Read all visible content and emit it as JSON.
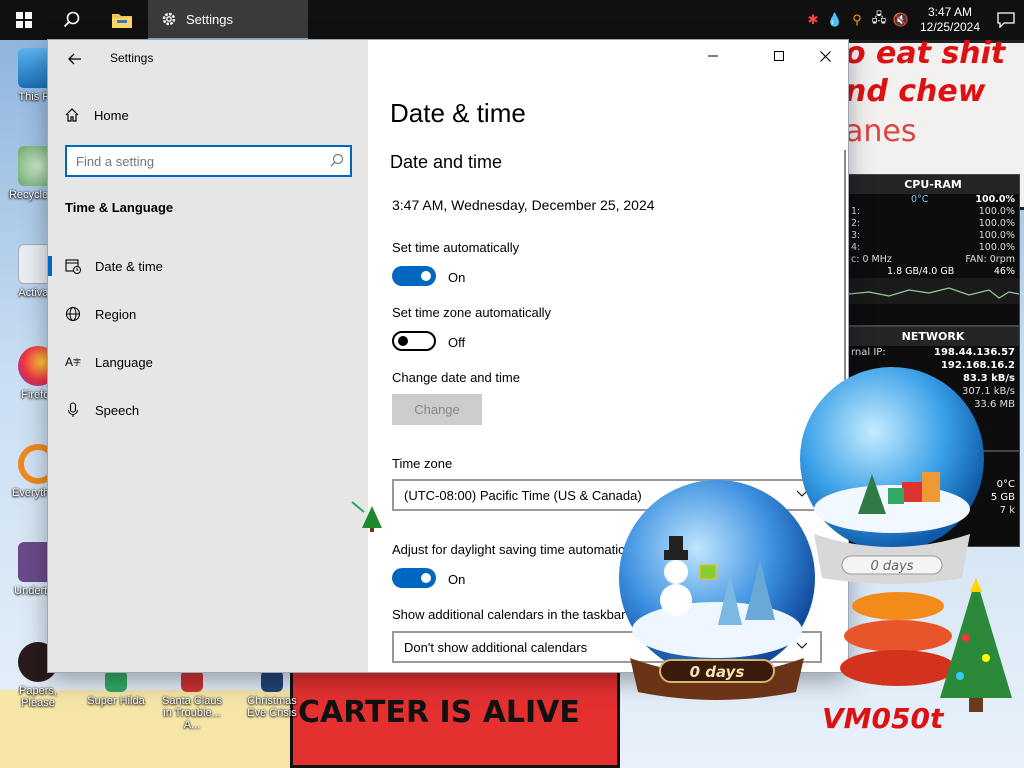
{
  "taskbar": {
    "settings_label": "Settings",
    "clock_time": "3:47 AM",
    "clock_date": "12/25/2024"
  },
  "desktop": {
    "icons": [
      {
        "label": "This PC"
      },
      {
        "label": "Recycle Bin"
      },
      {
        "label": "Activate"
      },
      {
        "label": "Firefox"
      },
      {
        "label": "Everything"
      },
      {
        "label": "Undertale"
      },
      {
        "label": "Papers, Please"
      },
      {
        "label": "Super Hilda"
      },
      {
        "label": "Santa Claus in Trouble... A..."
      },
      {
        "label": "Christmas Eve Crisis"
      }
    ],
    "wallpaper_top_lines": [
      "o eat shit",
      "nd chew",
      "anes"
    ],
    "wallpaper_bottom_lines": [
      "CARTER IS ALIVE"
    ],
    "wallpaper_tag": "VM050t",
    "globe_days_label": "0 days"
  },
  "gadgets": {
    "cpu_title": "CPU-RAM",
    "cpu_temp": "0°C",
    "cpu_total": "100.0%",
    "cores": [
      {
        "name": "1:",
        "value": "100.0%"
      },
      {
        "name": "2:",
        "value": "100.0%"
      },
      {
        "name": "3:",
        "value": "100.0%"
      },
      {
        "name": "4:",
        "value": "100.0%"
      }
    ],
    "cpu_freq": "c: 0 MHz",
    "fan": "FAN: 0rpm",
    "ram": "1.8 GB/4.0 GB",
    "ram_pct": "46%",
    "net_title": "NETWORK",
    "net_label": "rnal IP:",
    "net_external_ip": "198.44.136.57",
    "net_internal_ip": "192.168.16.2",
    "net_up": "83.3 kB/s",
    "net_down": "307.1 kB/s",
    "net_total": "33.6 MB",
    "temp": "0°C",
    "temp_size": "5 GB",
    "temp_k": "7 k"
  },
  "window": {
    "title": "Settings",
    "sidebar": {
      "home_label": "Home",
      "search_placeholder": "Find a setting",
      "section_title": "Time & Language",
      "items": [
        {
          "label": "Date & time",
          "active": true
        },
        {
          "label": "Region"
        },
        {
          "label": "Language"
        },
        {
          "label": "Speech"
        }
      ]
    },
    "content": {
      "page_title": "Date & time",
      "section_title": "Date and time",
      "current_datetime": "3:47 AM, Wednesday, December 25, 2024",
      "set_time_auto_label": "Set time automatically",
      "set_time_auto_state": "On",
      "set_tz_auto_label": "Set time zone automatically",
      "set_tz_auto_state": "Off",
      "change_label": "Change date and time",
      "change_button": "Change",
      "timezone_label": "Time zone",
      "timezone_value": "(UTC-08:00) Pacific Time (US & Canada)",
      "dst_label": "Adjust for daylight saving time automatically",
      "dst_state": "On",
      "calendars_label": "Show additional calendars in the taskbar",
      "calendars_value": "Don't show additional calendars"
    }
  },
  "colors": {
    "accent": "#0067c0",
    "taskbar": "#101010",
    "sidebar": "#e6e6e6"
  }
}
